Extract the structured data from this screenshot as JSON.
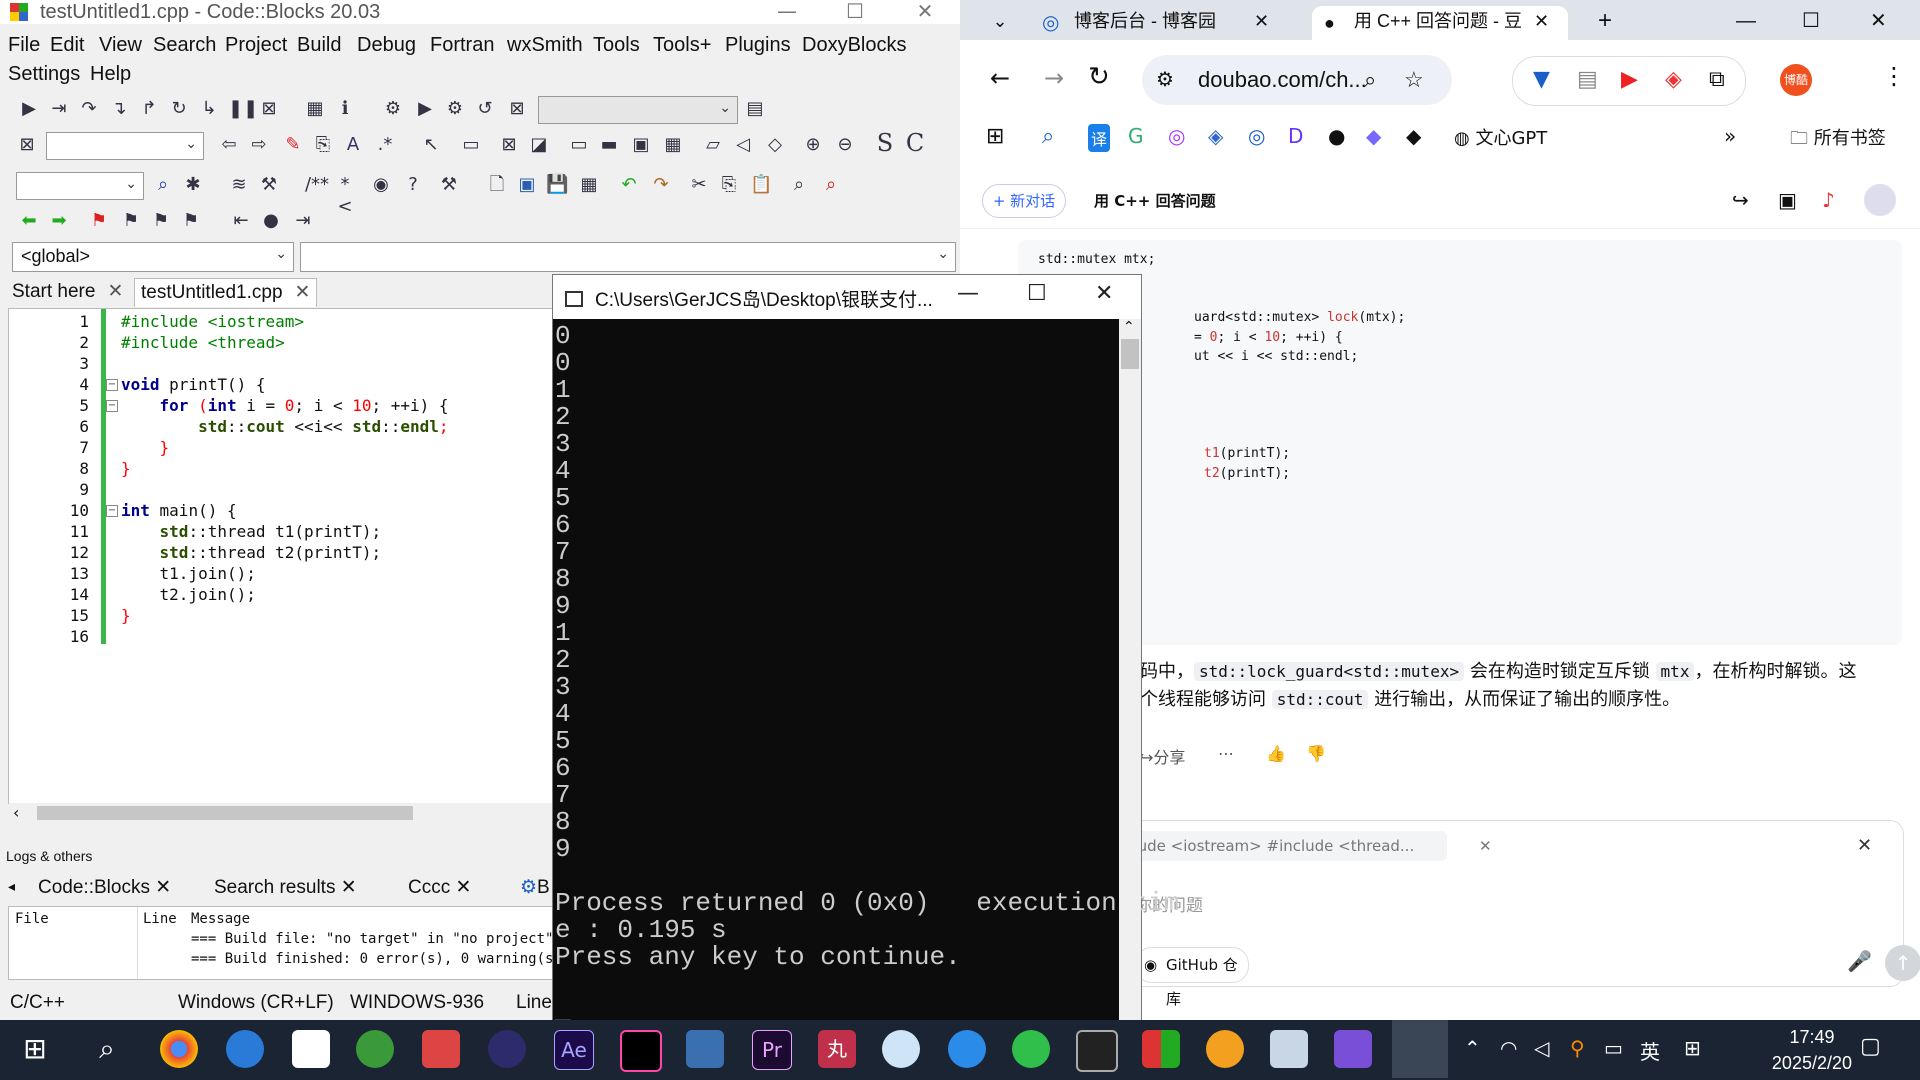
{
  "codeblocks": {
    "title": "testUntitled1.cpp - Code::Blocks 20.03",
    "menu": [
      "File",
      "Edit",
      "View",
      "Search",
      "Project",
      "Build",
      "Debug",
      "Fortran",
      "wxSmith",
      "Tools",
      "Tools+",
      "Plugins",
      "DoxyBlocks",
      "Settings",
      "Help"
    ],
    "scope_combo": "<global>",
    "tabs": [
      "Start here",
      "testUntitled1.cpp"
    ],
    "line_numbers": [
      "1",
      "2",
      "3",
      "4",
      "5",
      "6",
      "7",
      "8",
      "9",
      "10",
      "11",
      "12",
      "13",
      "14",
      "15",
      "16"
    ],
    "code": {
      "l1": "#include <iostream>",
      "l2": "#include <thread>",
      "l4a": "void",
      "l4b": " printT() {",
      "l5a": "    for",
      "l5b": " (",
      "l5c": "int",
      "l5d": " i = ",
      "l5e": "0",
      "l5f": "; i < ",
      "l5g": "10",
      "l5h": "; ++i) {",
      "l6a": "        std",
      "l6b": "::",
      "l6c": "cout",
      "l6d": " <<i<< ",
      "l6e": "std",
      "l6f": "::",
      "l6g": "endl",
      "l6h": ";",
      "l7": "    }",
      "l8": "}",
      "l10a": "int",
      "l10b": " main() {",
      "l11a": "    std",
      "l11b": "::thread t1(printT);",
      "l12a": "    std",
      "l12b": "::thread t2(printT);",
      "l13": "    t1.join();",
      "l14": "    t2.join();",
      "l15": "}"
    },
    "logs_header": "Logs & others",
    "logs_tabs": [
      "Code::Blocks",
      "Search results",
      "Cccc",
      "B"
    ],
    "logs_columns": [
      "File",
      "Line",
      "Message"
    ],
    "logs_messages": [
      "=== Build file: \"no target\" in \"no project\" (",
      "=== Build finished: 0 error(s), 0 warning(s)"
    ],
    "status": [
      "C/C++",
      "Windows (CR+LF)",
      "WINDOWS-936",
      "Line"
    ]
  },
  "console": {
    "title": "C:\\Users\\GerJCS岛\\Desktop\\银联支付...",
    "output": "0\n0\n1\n2\n3\n4\n5\n6\n7\n8\n9\n1\n2\n3\n4\n5\n6\n7\n8\n9\n\nProcess returned 0 (0x0)   execution tim\ne : 0.195 s\nPress any key to continue.\n\n_"
  },
  "browser": {
    "tabs": [
      {
        "title": "博客后台 - 博客园"
      },
      {
        "title": "用 C++ 回答问题 - 豆"
      }
    ],
    "url": "doubao.com/ch...",
    "bookmarks": [
      "译",
      "文心GPT",
      "所有书签"
    ],
    "profile_label": "博酷",
    "new_chat": "+ 新对话",
    "conversation_title": "用 C++ 回答问题",
    "code_lines": [
      {
        "text": "std::mutex mtx;"
      },
      {
        "pre": "uard<std::mutex> ",
        "fn": "lock",
        "post": "(mtx);"
      },
      {
        "pre": "= ",
        "n1": "0",
        "mid": "; i < ",
        "n2": "10",
        "post": "; ++i) {"
      },
      {
        "text": "ut << i << std::endl;"
      },
      {
        "fn": "t1",
        "post": "(printT);"
      },
      {
        "fn": "t2",
        "post": "(printT);"
      }
    ],
    "answer": {
      "p1": "码中，",
      "c1": "std::lock_guard<std::mutex>",
      "p2": " 会在构造时锁定互斥锁 ",
      "c2": "mtx",
      "p3": "，在析构时解锁。这",
      "p4": "个线程能够访问 ",
      "c3": "std::cout",
      "p5": " 进行输出，从而保证了输出的顺序性。"
    },
    "share": "分享",
    "attachment": "#include <iostream> #include <thread...",
    "input_placeholder": "你的问题",
    "github_chip": "GitHub 仓库"
  },
  "taskbar": {
    "time": "17:49",
    "date": "2025/2/20",
    "ime": "英",
    "app_labels": [
      "Ae",
      "Pr",
      "丸"
    ]
  }
}
